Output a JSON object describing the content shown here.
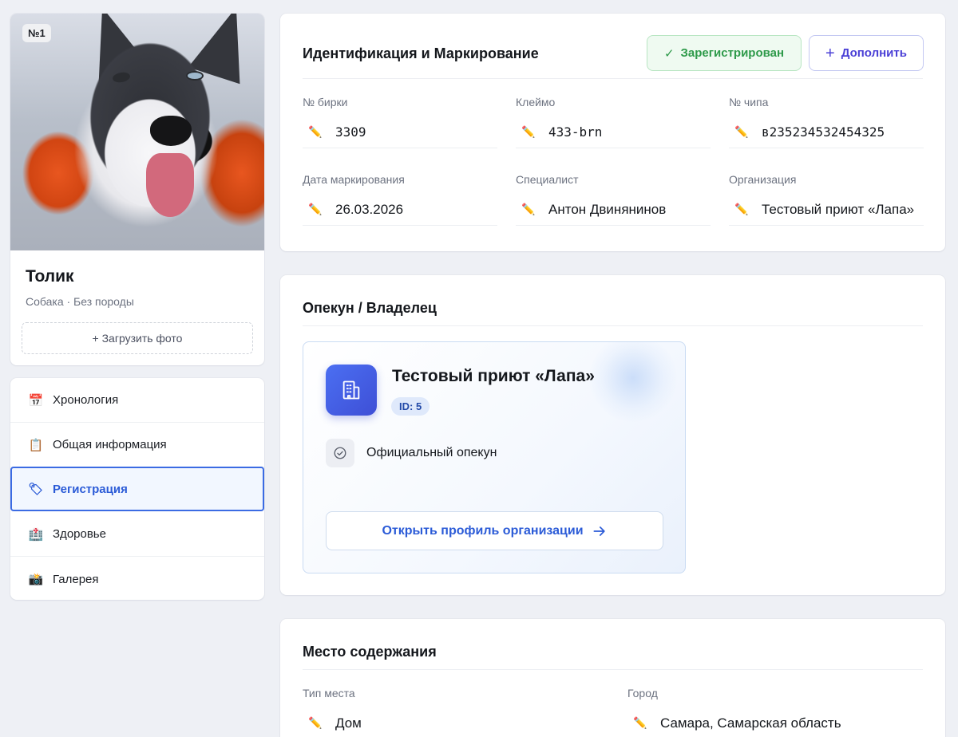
{
  "profile": {
    "badge": "№1",
    "name": "Толик",
    "subtitle": "Собака · Без породы",
    "upload_label": "+ Загрузить фото"
  },
  "menu": {
    "items": [
      {
        "icon": "📅",
        "label": "Хронология",
        "active": false
      },
      {
        "icon": "📋",
        "label": "Общая информация",
        "active": false
      },
      {
        "icon": "🏷",
        "label": "Регистрация",
        "active": true
      },
      {
        "icon": "🏥",
        "label": "Здоровье",
        "active": false
      },
      {
        "icon": "📸",
        "label": "Галерея",
        "active": false
      }
    ]
  },
  "identification": {
    "title": "Идентификация и Маркирование",
    "status_label": "Зарегистрирован",
    "add_label": "Дополнить",
    "fields": [
      {
        "label": "№ бирки",
        "value": "3309"
      },
      {
        "label": "Клеймо",
        "value": "433-brn"
      },
      {
        "label": "№ чипа",
        "value": "в235234532454325"
      },
      {
        "label": "Дата маркирования",
        "value": "26.03.2026"
      },
      {
        "label": "Специалист",
        "value": "Антон Двинянинов"
      },
      {
        "label": "Организация",
        "value": "Тестовый приют «Лапа»"
      }
    ]
  },
  "owner": {
    "title": "Опекун / Владелец",
    "org_name": "Тестовый приют «Лапа»",
    "org_id": "ID: 5",
    "role": "Официальный опекун",
    "open_label": "Открыть профиль организации"
  },
  "place": {
    "title": "Место содержания",
    "fields": [
      {
        "label": "Тип места",
        "value": "Дом"
      },
      {
        "label": "Город",
        "value": "Самара, Самарская область"
      }
    ]
  },
  "colors": {
    "accent": "#2b5bd7",
    "success": "#2e9a4a",
    "add_accent": "#4a3fd6",
    "background": "#eef0f5"
  },
  "icons": {
    "pencil": "✏️",
    "check": "✓",
    "arrow": "→"
  }
}
